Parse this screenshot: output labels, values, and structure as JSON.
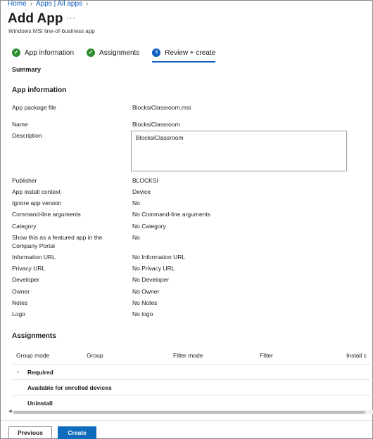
{
  "breadcrumb": {
    "home": "Home",
    "apps": "Apps | All apps"
  },
  "header": {
    "title": "Add App",
    "more": "···",
    "subtitle": "Windows MSI line-of-business app"
  },
  "steps": [
    {
      "label": "App information",
      "status": "complete"
    },
    {
      "label": "Assignments",
      "status": "complete"
    },
    {
      "label": "Review + create",
      "status": "active",
      "number": "3"
    }
  ],
  "summary_label": "Summary",
  "app_info": {
    "section_title": "App information",
    "fields": [
      {
        "label": "App package file",
        "value": "BlocksiClassroom.msi"
      },
      {
        "label": "Name",
        "value": "BlocksiClassroom"
      },
      {
        "label": "Description",
        "value": "BlocksiClassroom"
      },
      {
        "label": "Publisher",
        "value": "BLOCKSI"
      },
      {
        "label": "App install context",
        "value": "Device"
      },
      {
        "label": "Ignore app version",
        "value": "No"
      },
      {
        "label": "Command-line arguments",
        "value": "No Command-line arguments"
      },
      {
        "label": "Category",
        "value": "No Category"
      },
      {
        "label": "Show this as a featured app in the Company Portal",
        "label_line1": "Show this as a featured app in the",
        "label_line2": "Company Portal",
        "value": "No"
      },
      {
        "label": "Information URL",
        "value": "No Information URL"
      },
      {
        "label": "Privacy URL",
        "value": "No Privacy URL"
      },
      {
        "label": "Developer",
        "value": "No Developer"
      },
      {
        "label": "Owner",
        "value": "No Owner"
      },
      {
        "label": "Notes",
        "value": "No Notes"
      },
      {
        "label": "Logo",
        "value": "No logo"
      }
    ]
  },
  "assignments": {
    "section_title": "Assignments",
    "columns": [
      "Group mode",
      "Group",
      "Filter mode",
      "Filter",
      "Install c"
    ],
    "groups": [
      "Required",
      "Available for enrolled devices",
      "Uninstall"
    ]
  },
  "footer": {
    "previous": "Previous",
    "create": "Create"
  },
  "colors": {
    "accent": "#0f6cbd",
    "check": "#2f8c2f",
    "link": "#0f5cb8"
  }
}
